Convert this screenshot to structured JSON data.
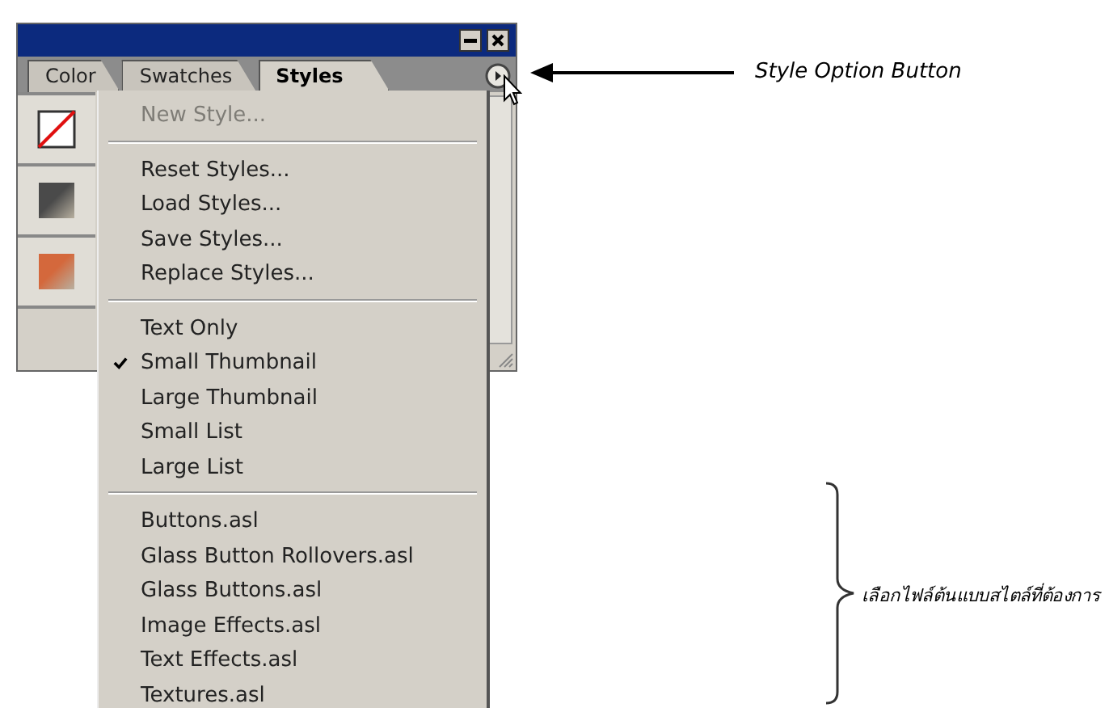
{
  "panel": {
    "title_buttons": [
      {
        "kind": "minimize"
      },
      {
        "kind": "close"
      }
    ],
    "tabs": [
      {
        "label": "Color",
        "selected": false
      },
      {
        "label": "Swatches",
        "selected": false
      },
      {
        "label": "Styles",
        "selected": true
      }
    ],
    "swatches": [
      {
        "kind": "none"
      },
      {
        "kind": "gradient",
        "color": "#4a4a4a"
      },
      {
        "kind": "gradient",
        "color": "#d4683c"
      }
    ]
  },
  "menu": {
    "items": [
      {
        "kind": "item",
        "label": "New Style...",
        "disabled": true,
        "checked": false
      },
      {
        "kind": "separator"
      },
      {
        "kind": "item",
        "label": "Reset Styles...",
        "disabled": false,
        "checked": false
      },
      {
        "kind": "item",
        "label": "Load Styles...",
        "disabled": false,
        "checked": false
      },
      {
        "kind": "item",
        "label": "Save Styles...",
        "disabled": false,
        "checked": false
      },
      {
        "kind": "item",
        "label": "Replace Styles...",
        "disabled": false,
        "checked": false
      },
      {
        "kind": "separator"
      },
      {
        "kind": "item",
        "label": "Text Only",
        "disabled": false,
        "checked": false
      },
      {
        "kind": "item",
        "label": "Small Thumbnail",
        "disabled": false,
        "checked": true
      },
      {
        "kind": "item",
        "label": "Large Thumbnail",
        "disabled": false,
        "checked": false
      },
      {
        "kind": "item",
        "label": "Small List",
        "disabled": false,
        "checked": false
      },
      {
        "kind": "item",
        "label": "Large List",
        "disabled": false,
        "checked": false
      },
      {
        "kind": "separator"
      },
      {
        "kind": "item",
        "label": "Buttons.asl",
        "disabled": false,
        "checked": false
      },
      {
        "kind": "item",
        "label": "Glass Button Rollovers.asl",
        "disabled": false,
        "checked": false
      },
      {
        "kind": "item",
        "label": "Glass Buttons.asl",
        "disabled": false,
        "checked": false
      },
      {
        "kind": "item",
        "label": "Image Effects.asl",
        "disabled": false,
        "checked": false
      },
      {
        "kind": "item",
        "label": "Text Effects.asl",
        "disabled": false,
        "checked": false
      },
      {
        "kind": "item",
        "label": "Textures.asl",
        "disabled": false,
        "checked": false
      }
    ]
  },
  "annotations": [
    {
      "kind": "arrow",
      "text": "Style Option Button"
    },
    {
      "kind": "brace",
      "text": "เลือกไฟล์ต้นแบบสไตล์ที่ต้องการ"
    }
  ]
}
